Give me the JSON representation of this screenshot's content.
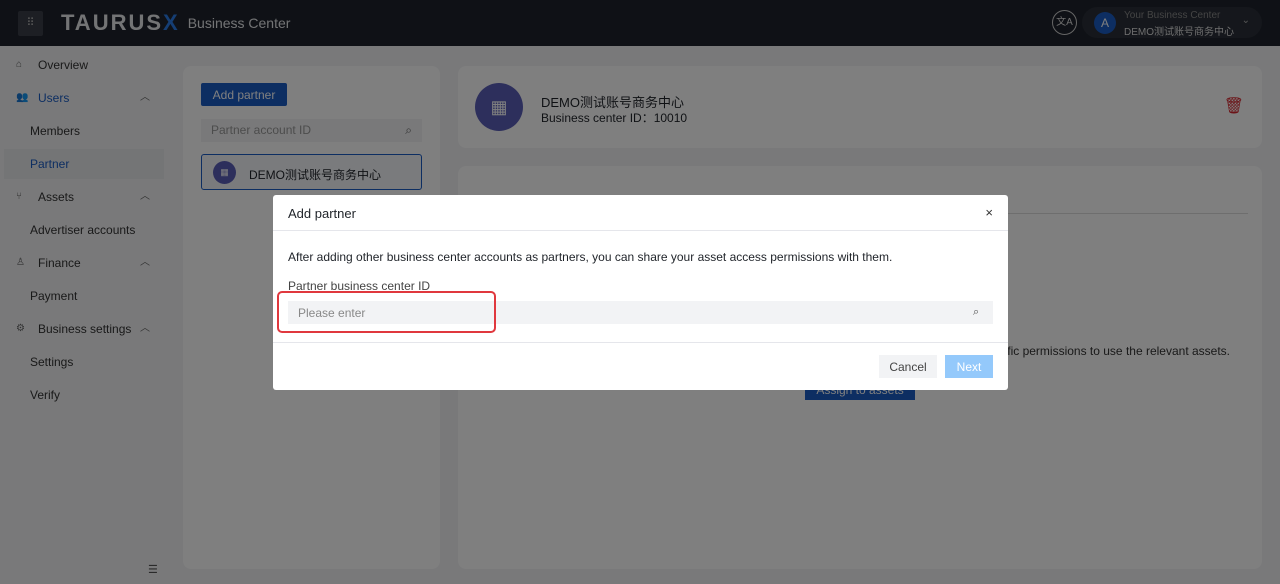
{
  "header": {
    "grid_icon": "apps-grid-icon",
    "logo_main": "TAURUS",
    "logo_accent": "X",
    "title": "Business Center",
    "language_icon": "translate-icon",
    "account": {
      "avatar": "A",
      "label": "Your Business Center",
      "name": "DEMO测试账号商务中心"
    }
  },
  "sidebar": {
    "items": [
      {
        "label": "Overview",
        "icon": "home-icon"
      },
      {
        "label": "Users",
        "icon": "users-icon"
      },
      {
        "label": "Members"
      },
      {
        "label": "Partner"
      },
      {
        "label": "Assets",
        "icon": "branch-icon"
      },
      {
        "label": "Advertiser accounts"
      },
      {
        "label": "Finance",
        "icon": "finance-icon"
      },
      {
        "label": "Payment"
      },
      {
        "label": "Business settings",
        "icon": "gear-icon"
      },
      {
        "label": "Settings"
      },
      {
        "label": "Verify"
      }
    ]
  },
  "partners": {
    "add_label": "Add partner",
    "search_placeholder": "Partner account ID",
    "list": [
      {
        "name": "DEMO测试账号商务中心"
      }
    ]
  },
  "detail": {
    "name": "DEMO测试账号商务中心",
    "id_label": "Business center ID：10010",
    "message_fragment": "ecific permissions to use the relevant assets.",
    "assign_label": "Assign to assets"
  },
  "modal": {
    "title": "Add partner",
    "description": "After adding other business center accounts as partners, you can share your asset access permissions with them.",
    "field_label": "Partner business center ID",
    "placeholder": "Please enter",
    "cancel": "Cancel",
    "next": "Next",
    "highlight_color": "#e0383e"
  }
}
